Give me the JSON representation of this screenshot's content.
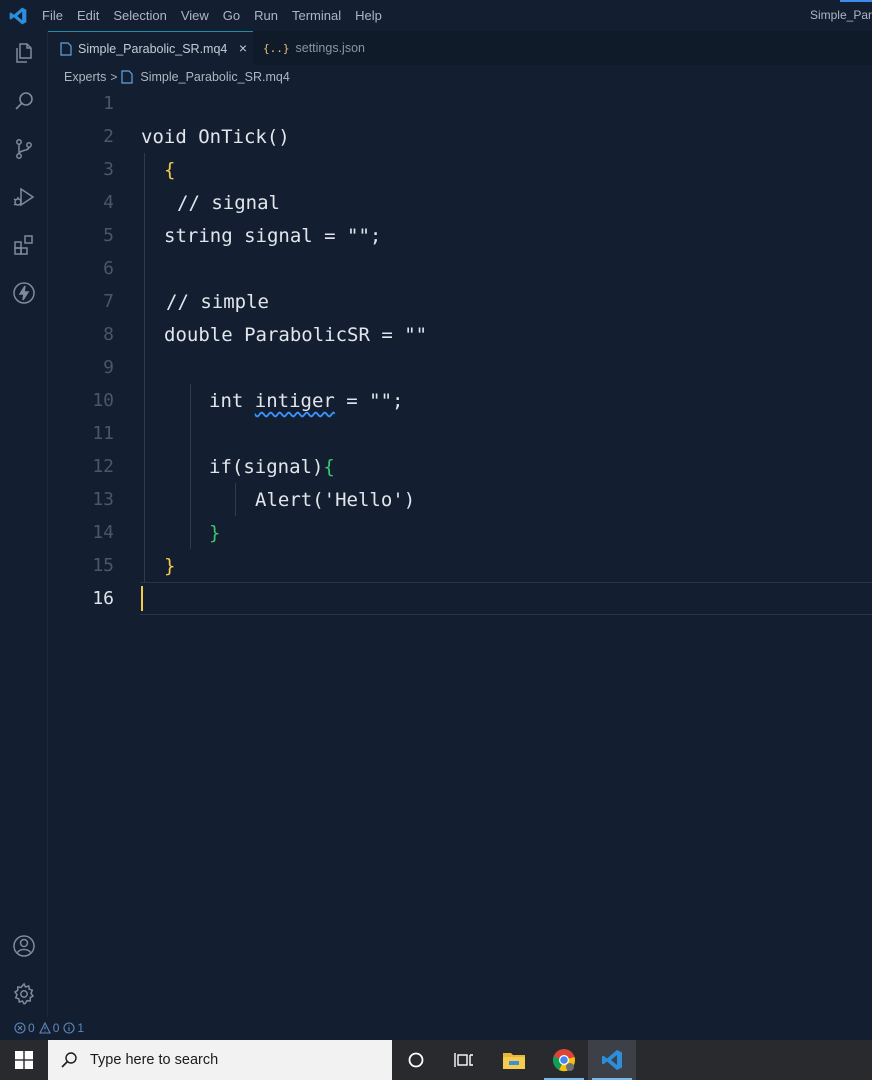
{
  "window": {
    "title": "Simple_Par",
    "menu": [
      "File",
      "Edit",
      "Selection",
      "View",
      "Go",
      "Run",
      "Terminal",
      "Help"
    ]
  },
  "activity_bar": {
    "top_icons": [
      "explorer-icon",
      "search-icon",
      "source-control-icon",
      "run-debug-icon",
      "extensions-icon",
      "lightning-icon"
    ],
    "bottom_icons": [
      "account-icon",
      "settings-gear-icon"
    ]
  },
  "tabs": [
    {
      "label": "Simple_Parabolic_SR.mq4",
      "active": true,
      "close": "×"
    },
    {
      "label": "settings.json",
      "active": false,
      "icon_text": "{..}"
    }
  ],
  "breadcrumb": {
    "folder": "Experts",
    "separator": ">",
    "file": "Simple_Parabolic_SR.mq4"
  },
  "editor": {
    "current_line": 16,
    "lines": [
      {
        "n": "1",
        "text": ""
      },
      {
        "n": "2",
        "text": "void OnTick()"
      },
      {
        "n": "3",
        "text": "{"
      },
      {
        "n": "4",
        "text": "// signal"
      },
      {
        "n": "5",
        "text": "string signal = \"\";"
      },
      {
        "n": "6",
        "text": ""
      },
      {
        "n": "7",
        "text": "// simple"
      },
      {
        "n": "8",
        "text": "double ParabolicSR = \"\""
      },
      {
        "n": "9",
        "text": ""
      },
      {
        "n": "10",
        "pre": "int ",
        "squiggle": "intiger",
        "post": " = \"\";"
      },
      {
        "n": "11",
        "text": ""
      },
      {
        "n": "12",
        "pre": "if(signal)",
        "brace": "{"
      },
      {
        "n": "13",
        "text": "Alert('Hello')"
      },
      {
        "n": "14",
        "text": "}"
      },
      {
        "n": "15",
        "text": "}"
      },
      {
        "n": "16",
        "text": ""
      }
    ]
  },
  "status_bar": {
    "errors": "0",
    "warnings": "0",
    "info": "1"
  },
  "taskbar": {
    "search_placeholder": "Type here to search",
    "apps": [
      "cortana-icon",
      "task-view-icon",
      "file-explorer-icon",
      "chrome-icon",
      "vscode-icon"
    ]
  },
  "colors": {
    "background": "#131f30",
    "bracket_yellow": "#f7c948",
    "bracket_green": "#3ec46d",
    "accent": "#1e8ea6"
  }
}
